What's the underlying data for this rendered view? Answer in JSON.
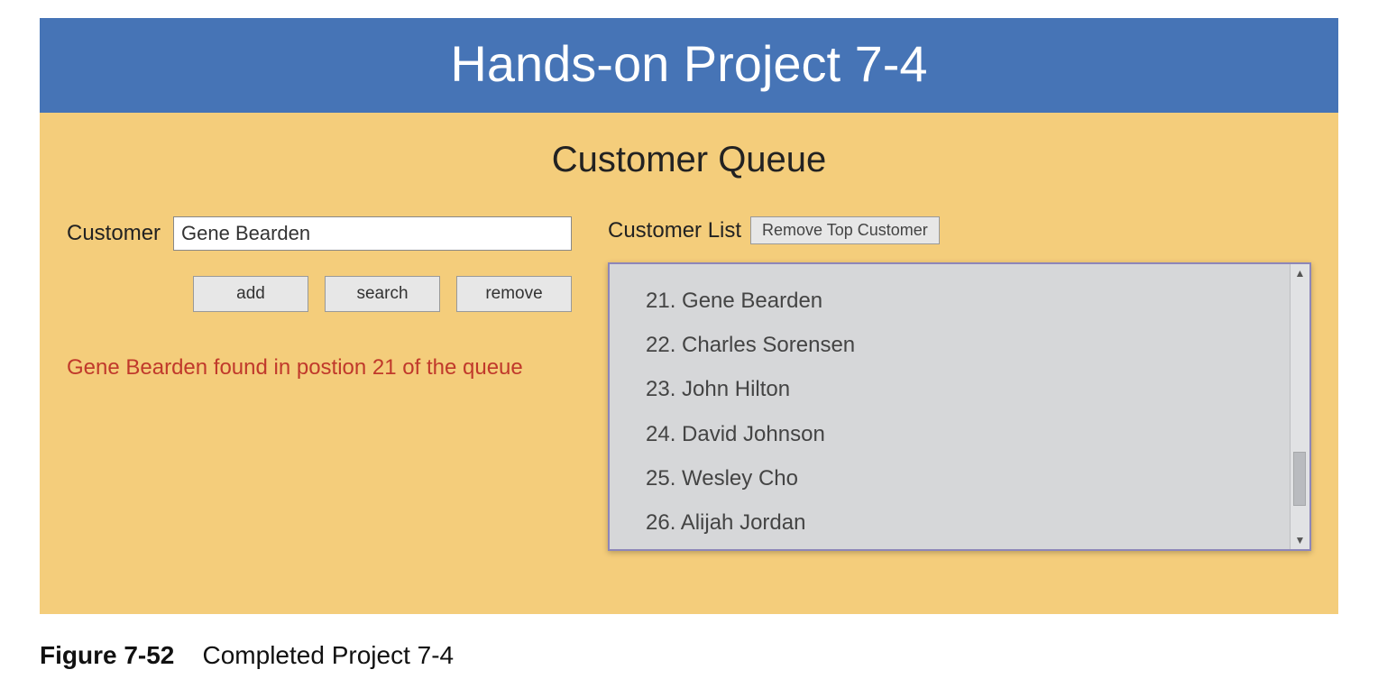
{
  "header": {
    "title": "Hands-on Project 7-4"
  },
  "panel": {
    "subtitle": "Customer Queue",
    "customer_label": "Customer",
    "customer_value": "Gene Bearden",
    "buttons": {
      "add": "add",
      "search": "search",
      "remove": "remove"
    },
    "status": "Gene Bearden found in postion 21 of the queue",
    "list_label": "Customer List",
    "remove_top": "Remove Top Customer",
    "items": [
      {
        "num": 21,
        "name": "Gene Bearden"
      },
      {
        "num": 22,
        "name": "Charles Sorensen"
      },
      {
        "num": 23,
        "name": "John Hilton"
      },
      {
        "num": 24,
        "name": "David Johnson"
      },
      {
        "num": 25,
        "name": "Wesley Cho"
      },
      {
        "num": 26,
        "name": "Alijah Jordan"
      }
    ]
  },
  "caption": {
    "bold": "Figure 7-52",
    "rest": "Completed Project 7-4"
  }
}
